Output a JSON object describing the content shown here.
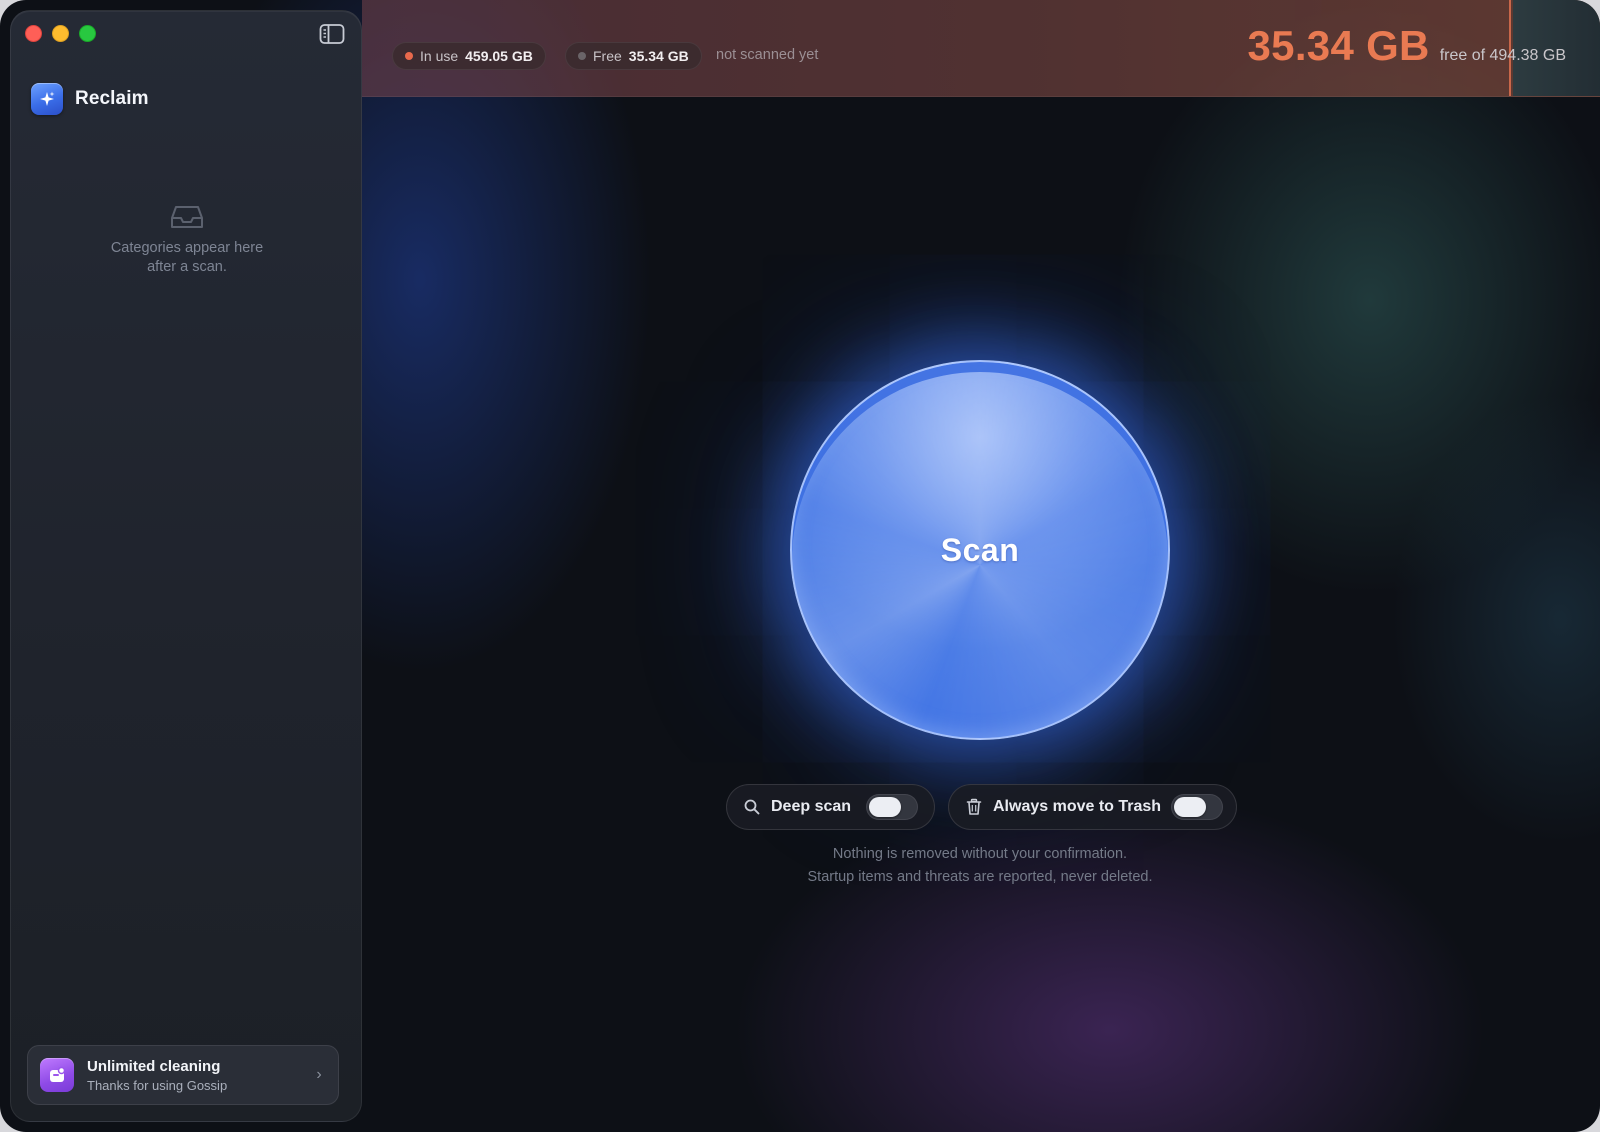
{
  "sidebar": {
    "app_name": "Reclaim",
    "empty_line1": "Categories appear here",
    "empty_line2": "after a scan.",
    "promo": {
      "title": "Unlimited cleaning",
      "subtitle": "Thanks for using Gossip"
    }
  },
  "storage": {
    "in_use_label": "In use",
    "in_use_value": "459.05 GB",
    "free_label": "Free",
    "free_value": "35.34 GB",
    "scan_status": "not scanned yet",
    "headline_value": "35.34 GB",
    "headline_caption": "free of 494.38 GB",
    "used_fraction": 0.9285
  },
  "main": {
    "scan_label": "Scan",
    "options": {
      "deep_scan_label": "Deep scan",
      "deep_scan_enabled": false,
      "trash_label": "Always move to Trash",
      "trash_enabled": false
    },
    "note_line1": "Nothing is removed without your confirmation.",
    "note_line2": "Startup items and threats are reported, never deleted."
  },
  "colors": {
    "accent_blue": "#3d70e4",
    "used_dot": "#e8694c",
    "free_dot": "#6a6468",
    "headline_orange": "#e97a52"
  },
  "icons": [
    "sidebar-toggle-icon",
    "sparkle-icon",
    "tray-icon",
    "gift-icon",
    "chevron-right-icon",
    "search-icon",
    "trash-icon"
  ]
}
